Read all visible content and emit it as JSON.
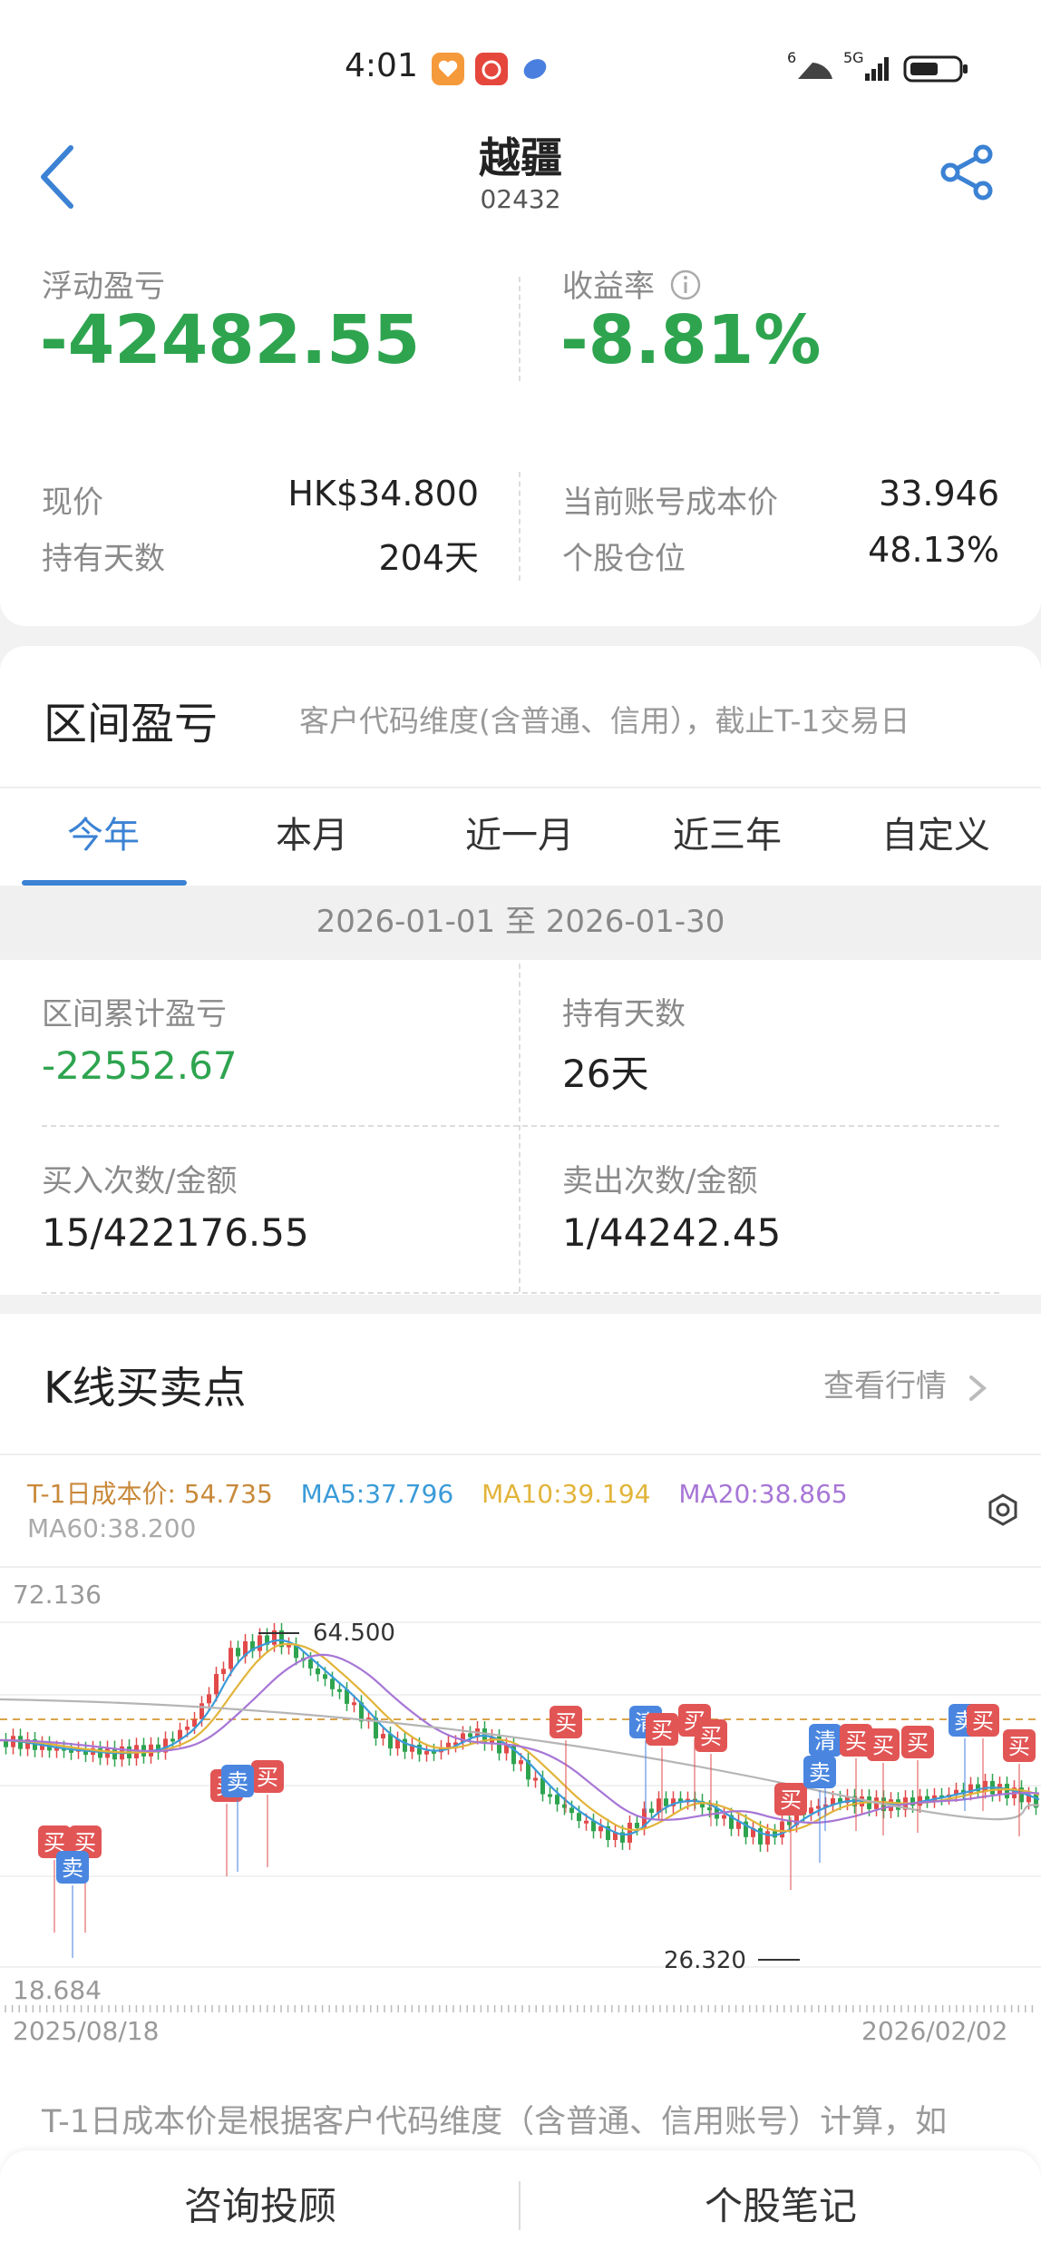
{
  "status_bar": {
    "time": "4:01",
    "app_icons": [
      "heart-app-icon",
      "camera-app-icon",
      "compass-app-icon"
    ],
    "wifi_label": "6",
    "cell_label": "5G",
    "battery": "battery-icon"
  },
  "header": {
    "title": "越疆",
    "code": "02432"
  },
  "summary": {
    "float_pl_label": "浮动盈亏",
    "float_pl_value": "-42482.55",
    "yield_label": "收益率",
    "yield_value": "-8.81%",
    "price_label": "现价",
    "price_value": "HK$34.800",
    "cost_label": "当前账号成本价",
    "cost_value": "33.946",
    "days_label": "持有天数",
    "days_value": "204天",
    "position_label": "个股仓位",
    "position_value": "48.13%"
  },
  "range": {
    "title": "区间盈亏",
    "note": "客户代码维度(含普通、信用），截止T-1交易日",
    "tabs": [
      "今年",
      "本月",
      "近一月",
      "近三年",
      "自定义"
    ],
    "active_tab": 0,
    "date_range": "2026-01-01 至 2026-01-30",
    "cum_pl_label": "区间累计盈亏",
    "cum_pl_value": "-22552.67",
    "hold_days_label": "持有天数",
    "hold_days_value": "26天",
    "buy_label": "买入次数/金额",
    "buy_value": "15/422176.55",
    "sell_label": "卖出次数/金额",
    "sell_value": "1/44242.45"
  },
  "kline": {
    "title": "K线买卖点",
    "quote_link": "查看行情",
    "cost_line": "T-1日成本价: 54.735",
    "ma5": "MA5:37.796",
    "ma10": "MA10:39.194",
    "ma20": "MA20:38.865",
    "ma60": "MA60:38.200",
    "colors": {
      "cost": "#c8893a",
      "ma5": "#3a9bd8",
      "ma10": "#e2b43a",
      "ma20": "#a776d6",
      "ma60": "#b5b5b5",
      "up": "#e24a4a",
      "down": "#2ea44f",
      "buy_marker": "#e25555",
      "sell_marker": "#4a86e0"
    },
    "y_max": "72.136",
    "y_min": "18.684",
    "high_label": "64.500",
    "low_label": "26.320",
    "x_start": "2025/08/18",
    "x_end": "2026/02/02",
    "marker_buy": "买",
    "marker_sell": "卖",
    "marker_clear": "清",
    "footnote": "T-1日成本价是根据客户代码维度（含普通、信用账号）计算，如"
  },
  "bottom_bar": {
    "left": "咨询投顾",
    "right": "个股笔记"
  }
}
